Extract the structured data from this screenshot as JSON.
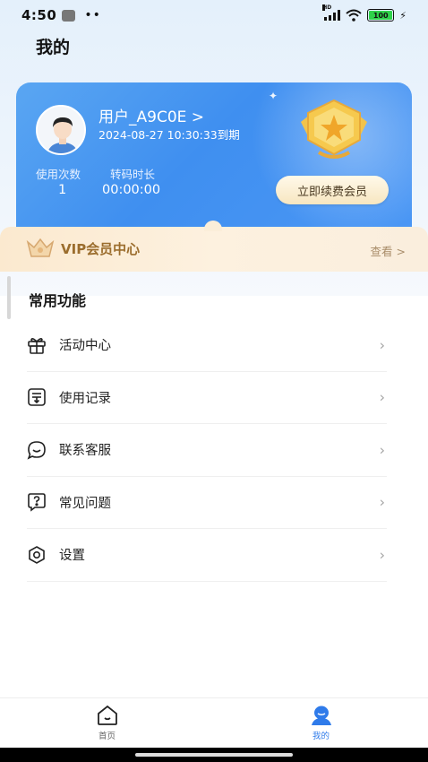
{
  "status_bar": {
    "time": "4:50",
    "dots": "••",
    "battery": "100"
  },
  "page": {
    "title": "我的"
  },
  "card": {
    "user_name": "用户_A9C0E >",
    "expire": "2024-08-27 10:30:33到期",
    "stats": [
      {
        "label": "使用次数",
        "value": "1"
      },
      {
        "label": "转码时长",
        "value": "00:00:00"
      }
    ],
    "renew_button": "立即续费会员"
  },
  "vip": {
    "label": "VIP会员中心",
    "view": "查看 >"
  },
  "section": {
    "title": "常用功能"
  },
  "menu": [
    {
      "label": "活动中心",
      "icon": "gift-icon"
    },
    {
      "label": "使用记录",
      "icon": "record-icon"
    },
    {
      "label": "联系客服",
      "icon": "chat-icon"
    },
    {
      "label": "常见问题",
      "icon": "question-icon"
    },
    {
      "label": "设置",
      "icon": "settings-icon"
    }
  ],
  "nav": [
    {
      "label": "首页",
      "icon": "home-icon",
      "active": false
    },
    {
      "label": "我的",
      "icon": "profile-icon",
      "active": true
    }
  ],
  "colors": {
    "accent": "#2f7bea",
    "card": "#4592f2",
    "vip_text": "#9b6d2d"
  }
}
